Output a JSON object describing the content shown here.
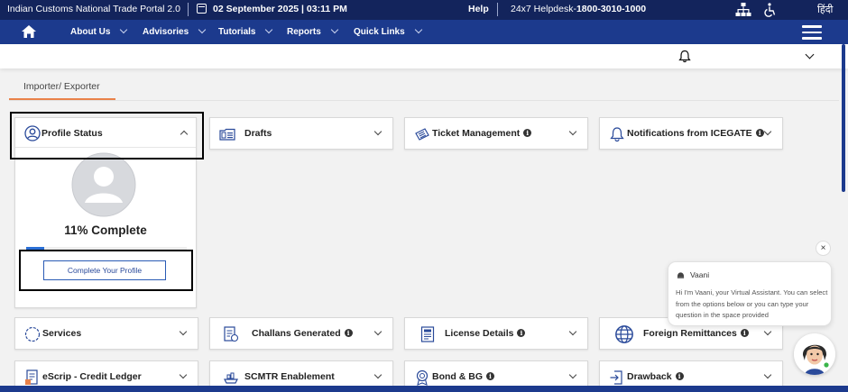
{
  "topbar": {
    "title": "Indian Customs National Trade Portal 2.0",
    "datetime": "02 September 2025 | 03:11 PM",
    "help": "Help",
    "helpdesk_prefix": "24x7 Helpdesk-",
    "helpdesk_number": "1800-3010-1000",
    "language": "हिंदी",
    "icons": [
      "calendar-icon",
      "sitemap-icon",
      "accessibility-icon"
    ]
  },
  "nav": {
    "items": [
      {
        "label": "About Us"
      },
      {
        "label": "Advisories"
      },
      {
        "label": "Tutorials"
      },
      {
        "label": "Reports"
      },
      {
        "label": "Quick Links"
      }
    ]
  },
  "tab": {
    "label": "Importer/ Exporter"
  },
  "profile": {
    "title": "Profile Status",
    "percent_text": "11% Complete",
    "progress": 0.11,
    "button": "Complete Your Profile"
  },
  "cards": {
    "drafts": "Drafts",
    "ticket": "Ticket Management",
    "notifications": "Notifications from ICEGATE",
    "services": "Services",
    "challans": "Challans Generated",
    "license": "License Details",
    "remittances": "Foreign Remittances",
    "escrip": "eScrip - Credit Ledger",
    "scmtr": "SCMTR Enablement",
    "bond": "Bond & BG",
    "drawback": "Drawback"
  },
  "chat": {
    "close": "×",
    "name": "Vaani",
    "message": "Hi I'm Vaani, your Virtual Assistant. You can select from the options below or you can type your question in the space provided"
  },
  "colors": {
    "topbar": "#13245c",
    "navbar": "#1c3a8d",
    "tab_accent": "#e9824a",
    "button_border": "#2a5bb5"
  }
}
